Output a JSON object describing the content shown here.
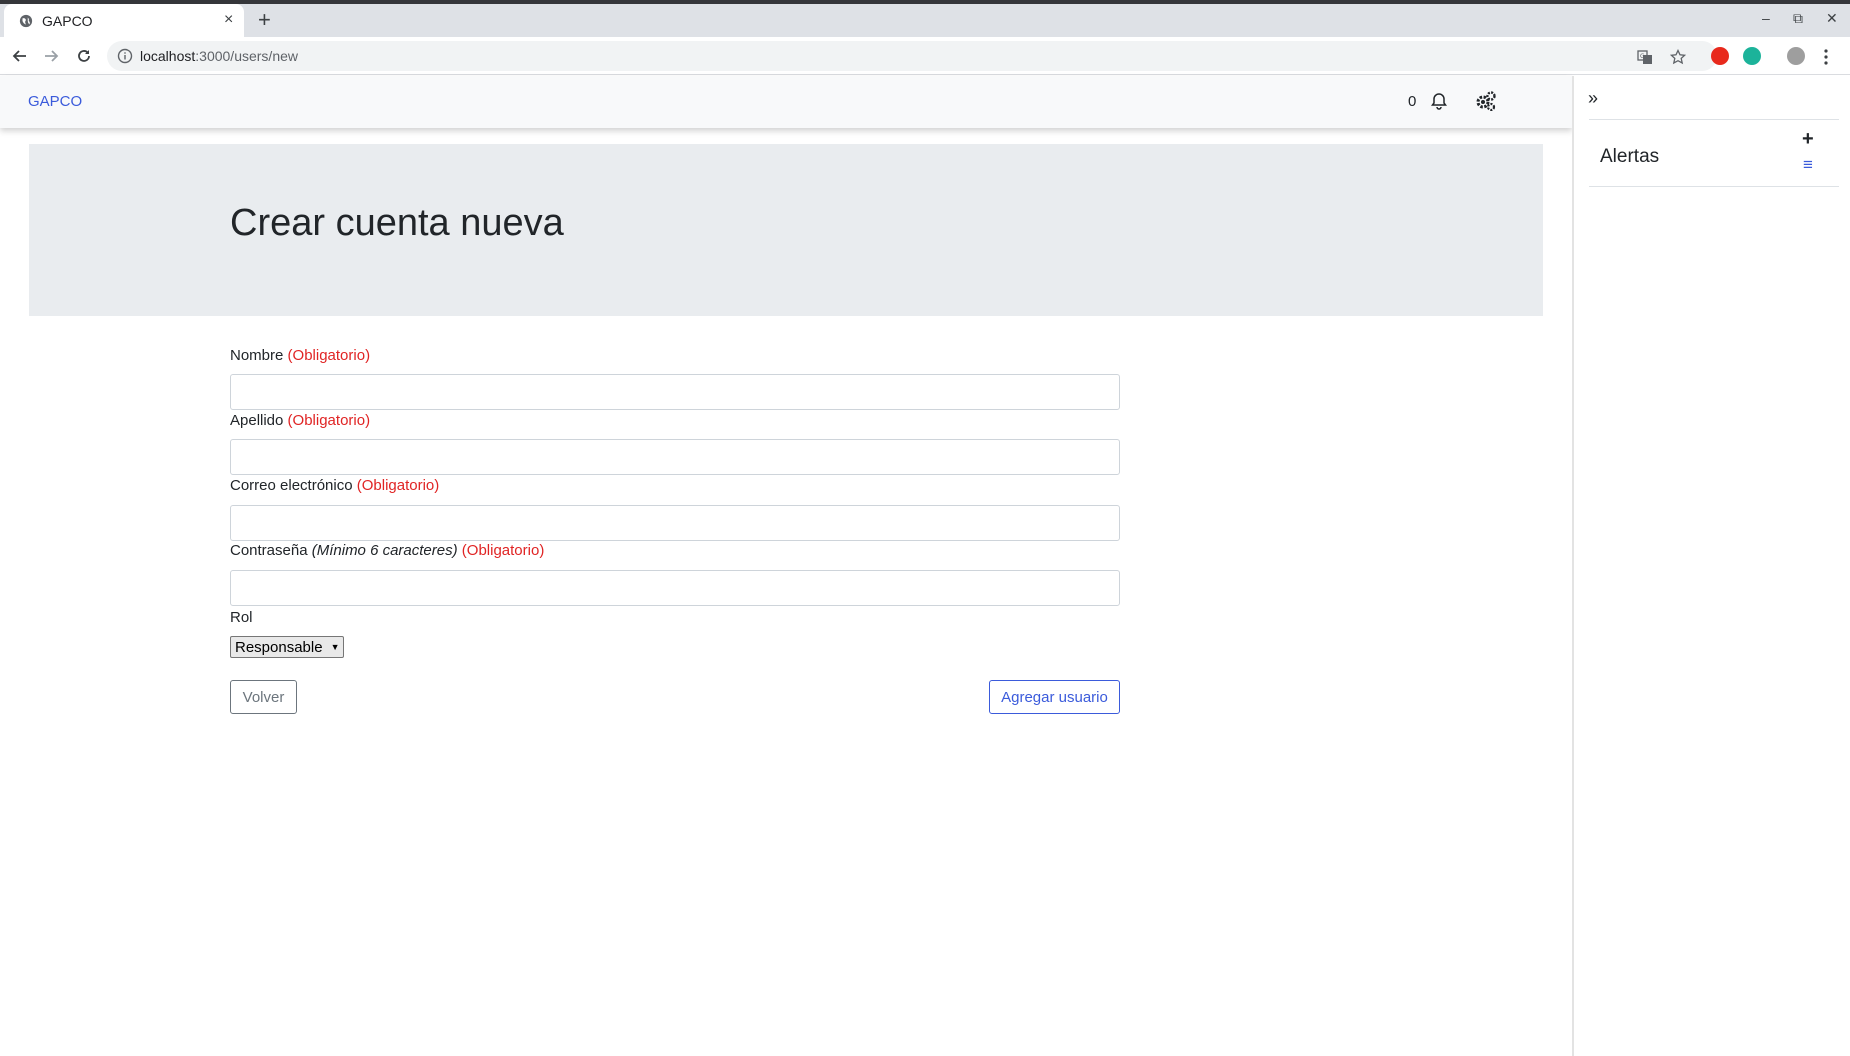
{
  "browser": {
    "tab_title": "GAPCO",
    "tab_close": "×",
    "new_tab": "+",
    "url_host": "localhost",
    "url_path": ":3000/users/new",
    "window_controls": [
      "–",
      "⧉",
      "✕"
    ]
  },
  "navbar": {
    "brand": "GAPCO",
    "notification_count": "0",
    "icons": [
      "bell-icon",
      "cogs-icon"
    ]
  },
  "page": {
    "title": "Crear cuenta nueva"
  },
  "form": {
    "required_text": "(Obligatorio)",
    "fields": [
      {
        "label": "Nombre",
        "value": ""
      },
      {
        "label": "Apellido",
        "value": ""
      },
      {
        "label": "Correo electrónico",
        "value": ""
      },
      {
        "label": "Contraseña",
        "hint": "(Mínimo 6 caracteres)",
        "value": ""
      }
    ],
    "role_label": "Rol",
    "role_selected": "Responsable",
    "back_button": "Volver",
    "submit_button": "Agregar usuario"
  },
  "sidebar": {
    "title": "Alertas",
    "collapse_icon": "»",
    "add_icon": "+",
    "list_icon": "≡"
  },
  "colors": {
    "brand_blue": "#3b5bdb",
    "required_red": "#e02424",
    "jumbotron_bg": "#e9ecef"
  }
}
